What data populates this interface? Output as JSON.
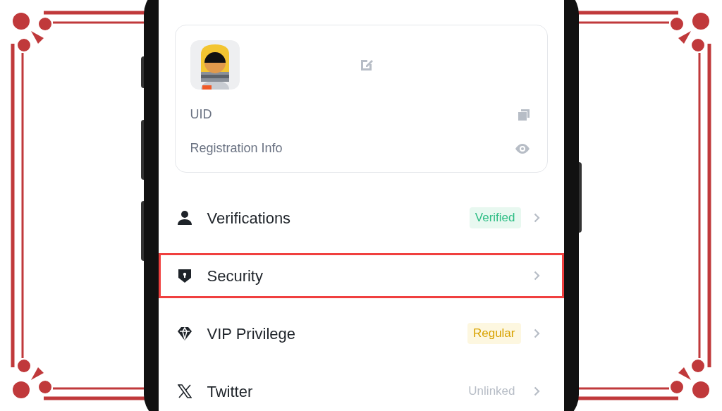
{
  "profile_card": {
    "uid_label": "UID",
    "registration_label": "Registration Info"
  },
  "menu": [
    {
      "label": "Verifications",
      "kind": "person",
      "badge": {
        "text": "Verified",
        "kind": "success"
      },
      "highlighted": false
    },
    {
      "label": "Security",
      "kind": "shield",
      "highlighted": true
    },
    {
      "label": "VIP Privilege",
      "kind": "diamond",
      "badge": {
        "text": "Regular",
        "kind": "warning"
      },
      "highlighted": false
    },
    {
      "label": "Twitter",
      "kind": "x",
      "badge": {
        "text": "Unlinked",
        "kind": "plain"
      },
      "highlighted": false
    }
  ]
}
